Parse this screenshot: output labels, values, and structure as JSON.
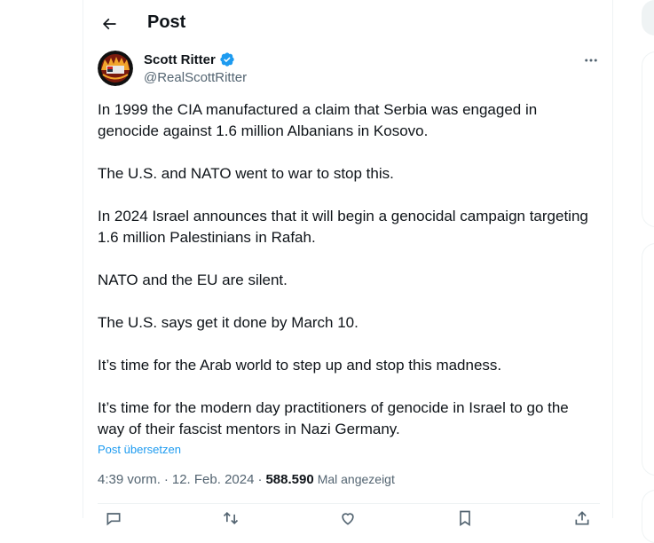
{
  "header": {
    "title": "Post"
  },
  "author": {
    "name": "Scott Ritter",
    "handle": "@RealScottRitter",
    "verified_color": "#1d9bf0"
  },
  "tweet": {
    "paragraphs": [
      "In 1999 the CIA manufactured a claim that Serbia was engaged in genocide against 1.6 million Albanians in Kosovo.",
      "The U.S. and NATO went to war to stop this.",
      "In 2024 Israel announces that it will begin a genocidal campaign targeting 1.6 million Palestinians in Rafah.",
      "NATO and the EU are silent.",
      "The U.S. says get it done by March 10.",
      "It’s time for the Arab world to step up and stop this madness.",
      "It’s time for the modern day practitioners of genocide in Israel to go the way of their fascist mentors in Nazi Germany."
    ],
    "translate_label": "Post übersetzen"
  },
  "meta": {
    "time": "4:39 vorm.",
    "separator": "·",
    "date": "12. Feb. 2024",
    "views_count": "588.590",
    "views_label": "Mal angezeigt"
  },
  "icons": {
    "back": "arrow-left-icon",
    "more": "more-icon",
    "verified": "verified-badge-icon",
    "actions": [
      "reply-icon",
      "repost-icon",
      "like-icon",
      "bookmark-icon",
      "share-icon"
    ]
  },
  "colors": {
    "accent": "#1d9bf0",
    "text": "#0f1419",
    "secondary": "#536471"
  }
}
